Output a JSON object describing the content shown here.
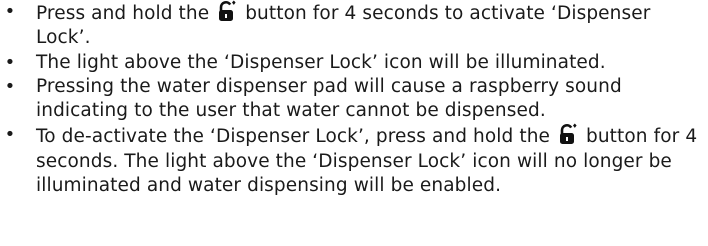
{
  "instructions": [
    {
      "id": "step-1",
      "before_icon": "Press and hold the ",
      "icon": "lock-icon",
      "after_icon": " button for 4 seconds to activate ‘Dispenser Lock’."
    },
    {
      "id": "step-2",
      "text": "The light above the ‘Dispenser Lock’ icon will be illuminated."
    },
    {
      "id": "step-3",
      "text": "Pressing the water dispenser pad will cause a raspberry sound indicating to the user that water cannot be dispensed."
    },
    {
      "id": "step-4",
      "before_icon": "To de-activate the ‘Dispenser Lock’, press and hold the ",
      "icon": "lock-icon",
      "after_icon": " button for 4 seconds. The light above the ‘Dispenser Lock’ icon will no longer be illuminated and water dispensing will be enabled."
    }
  ],
  "bullet_char": "•"
}
